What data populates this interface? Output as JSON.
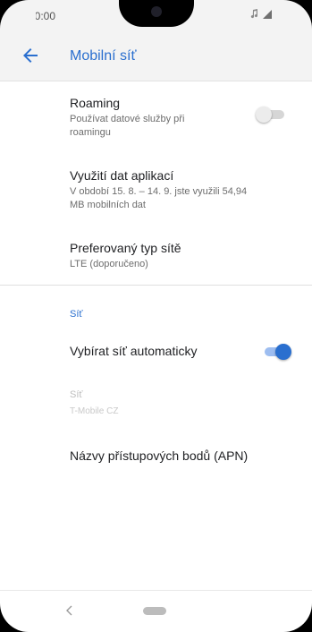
{
  "status_bar": {
    "time": "10:00",
    "icons": [
      "music-note-icon",
      "signal-icon",
      "battery-icon"
    ]
  },
  "toolbar": {
    "back_icon": "arrow-left-icon",
    "title": "Mobilní síť"
  },
  "settings": {
    "roaming": {
      "title": "Roaming",
      "summary": "Používat datové služby při roamingu",
      "toggle_on": false
    },
    "data_usage": {
      "title": "Využití dat aplikací",
      "summary": "V období 15. 8. – 14. 9. jste využili 54,94 MB mobilních dat"
    },
    "preferred_network": {
      "title": "Preferovaný typ sítě",
      "summary": "LTE (doporučeno)"
    },
    "network_section": {
      "header": "Síť",
      "auto_select": {
        "title": "Vybírat síť automaticky",
        "toggle_on": true
      },
      "network": {
        "title": "Síť",
        "summary": "T-Mobile CZ"
      }
    },
    "apn": {
      "title": "Názvy přístupových bodů (APN)"
    }
  },
  "colors": {
    "accent": "#2a6fcf",
    "background": "#ffffff",
    "toolbar": "#f3f3f3"
  },
  "nav_bar": {
    "icons": [
      "back-chevron-icon",
      "home-pill-icon"
    ]
  }
}
